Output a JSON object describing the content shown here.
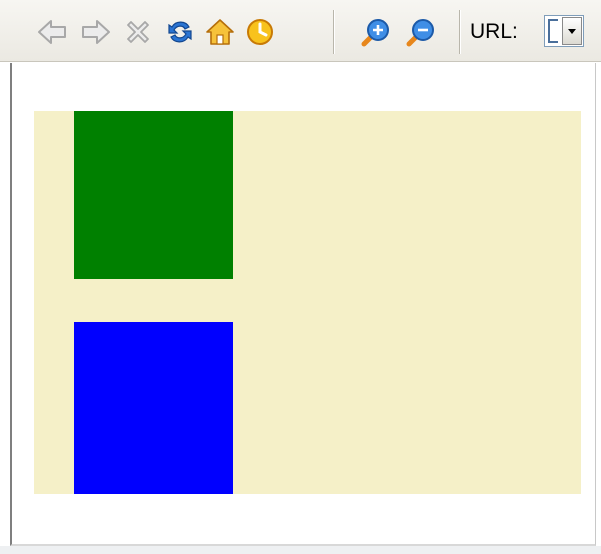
{
  "toolbar": {
    "buttons": [
      {
        "name": "back",
        "icon": "back-arrow-icon"
      },
      {
        "name": "forward",
        "icon": "forward-arrow-icon"
      },
      {
        "name": "stop",
        "icon": "stop-icon"
      },
      {
        "name": "reload",
        "icon": "reload-icon"
      },
      {
        "name": "home",
        "icon": "home-icon"
      },
      {
        "name": "history",
        "icon": "history-clock-icon"
      },
      {
        "name": "zoom-in",
        "icon": "zoom-in-icon"
      },
      {
        "name": "zoom-out",
        "icon": "zoom-out-icon"
      }
    ],
    "url_label": "URL:",
    "url_value": ""
  },
  "content": {
    "canvas_color": "#f5f0c8",
    "boxes": [
      {
        "name": "green-box",
        "color": "#008000"
      },
      {
        "name": "blue-box",
        "color": "#0000ff"
      }
    ]
  }
}
